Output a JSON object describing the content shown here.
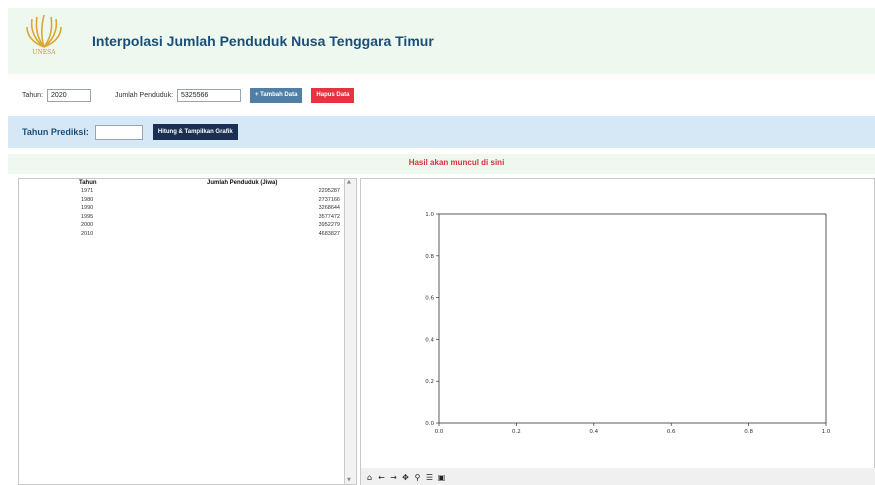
{
  "header": {
    "title": "Interpolasi Jumlah Penduduk Nusa Tenggara Timur",
    "logo_text": "UNESA",
    "logo_icon": "unesa-logo-icon"
  },
  "input_row": {
    "tahun_label": "Tahun:",
    "tahun_value": "2020",
    "jumlah_label": "Jumlah Penduduk:",
    "jumlah_value": "5325566",
    "add_button": "+ Tambah Data",
    "delete_button": "Hapus Data"
  },
  "predict": {
    "label": "Tahun Prediksi:",
    "value": "",
    "button": "Hitung & Tampilkan Grafik"
  },
  "result": {
    "text": "Hasil akan muncul di sini"
  },
  "table": {
    "columns": [
      "Tahun",
      "Jumlah Penduduk (Jiwa)"
    ],
    "rows": [
      [
        "1971",
        "2295287"
      ],
      [
        "1980",
        "2737166"
      ],
      [
        "1990",
        "3268644"
      ],
      [
        "1995",
        "3577472"
      ],
      [
        "2000",
        "3952279"
      ],
      [
        "2010",
        "4683827"
      ]
    ]
  },
  "chart": {
    "x_ticks": [
      "0.0",
      "0.2",
      "0.4",
      "0.6",
      "0.8",
      "1.0"
    ],
    "y_ticks": [
      "0.0",
      "0.2",
      "0.4",
      "0.6",
      "0.8",
      "1.0"
    ],
    "xlim": [
      0,
      1
    ],
    "ylim": [
      0,
      1
    ]
  },
  "toolbar": {
    "icons": [
      "home-icon",
      "back-arrow-icon",
      "forward-arrow-icon",
      "pan-icon",
      "zoom-icon",
      "configure-icon",
      "save-icon"
    ],
    "glyphs": [
      "⌂",
      "←",
      "→",
      "✥",
      "⚲",
      "☰",
      "▣"
    ]
  },
  "colors": {
    "title": "#1a4f7a",
    "result": "#d9303a",
    "add_button": "#4f7fa6",
    "delete_button": "#e5343f",
    "calc_button": "#1a2f52"
  }
}
